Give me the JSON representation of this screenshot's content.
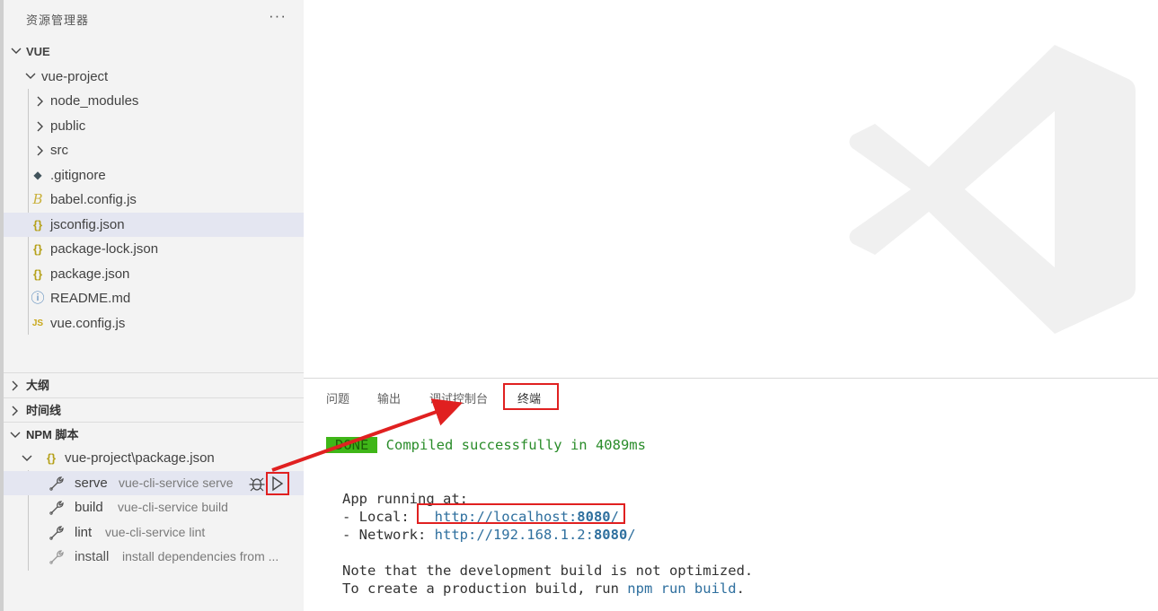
{
  "sidebar": {
    "title": "资源管理器",
    "more_label": "···",
    "root_label": "VUE",
    "project_label": "vue-project",
    "tree": [
      {
        "label": "node_modules",
        "type": "folder",
        "icon": "chevron-right-icon"
      },
      {
        "label": "public",
        "type": "folder",
        "icon": "chevron-right-icon"
      },
      {
        "label": "src",
        "type": "folder",
        "icon": "chevron-right-icon"
      },
      {
        "label": ".gitignore",
        "type": "file",
        "icon": "git-icon",
        "glyph": "◆"
      },
      {
        "label": "babel.config.js",
        "type": "file",
        "icon": "babel-icon",
        "glyph": "B"
      },
      {
        "label": "jsconfig.json",
        "type": "file",
        "icon": "json-icon",
        "glyph": "{}"
      },
      {
        "label": "package-lock.json",
        "type": "file",
        "icon": "json-icon",
        "glyph": "{}"
      },
      {
        "label": "package.json",
        "type": "file",
        "icon": "json-icon",
        "glyph": "{}"
      },
      {
        "label": "README.md",
        "type": "file",
        "icon": "info-icon",
        "glyph": "ⓘ"
      },
      {
        "label": "vue.config.js",
        "type": "file",
        "icon": "js-icon",
        "glyph": "JS"
      }
    ],
    "sections": {
      "outline": "大纲",
      "timeline": "时间线",
      "npm": "NPM 脚本"
    },
    "npm_file": "vue-project\\package.json",
    "npm_file_glyph": "{}",
    "scripts": [
      {
        "name": "serve",
        "command": "vue-cli-service serve"
      },
      {
        "name": "build",
        "command": "vue-cli-service build"
      },
      {
        "name": "lint",
        "command": "vue-cli-service lint"
      },
      {
        "name": "install",
        "command": "install dependencies from ..."
      }
    ]
  },
  "panel": {
    "tabs": [
      "问题",
      "输出",
      "调试控制台",
      "终端"
    ],
    "active_tab": "终端",
    "terminal": {
      "done_badge": "DONE",
      "compiled": "Compiled successfully in 4089ms",
      "app_running": "App running at:",
      "local_prefix": "- Local:   ",
      "local_url_a": "http://localhost:",
      "local_port": "8080",
      "local_url_c": "/",
      "network_prefix": "- Network: ",
      "network_url_a": "http://192.168.1.2:",
      "network_port": "8080",
      "network_url_c": "/",
      "note_line": "Note that the development build is not optimized.",
      "create_prefix": "To create a production build, run ",
      "create_cmd": "npm run build",
      "create_suffix": "."
    }
  },
  "colors": {
    "annotation_red": "#e02020",
    "done_green": "#3fb618",
    "link_blue": "#2e6f9e"
  }
}
